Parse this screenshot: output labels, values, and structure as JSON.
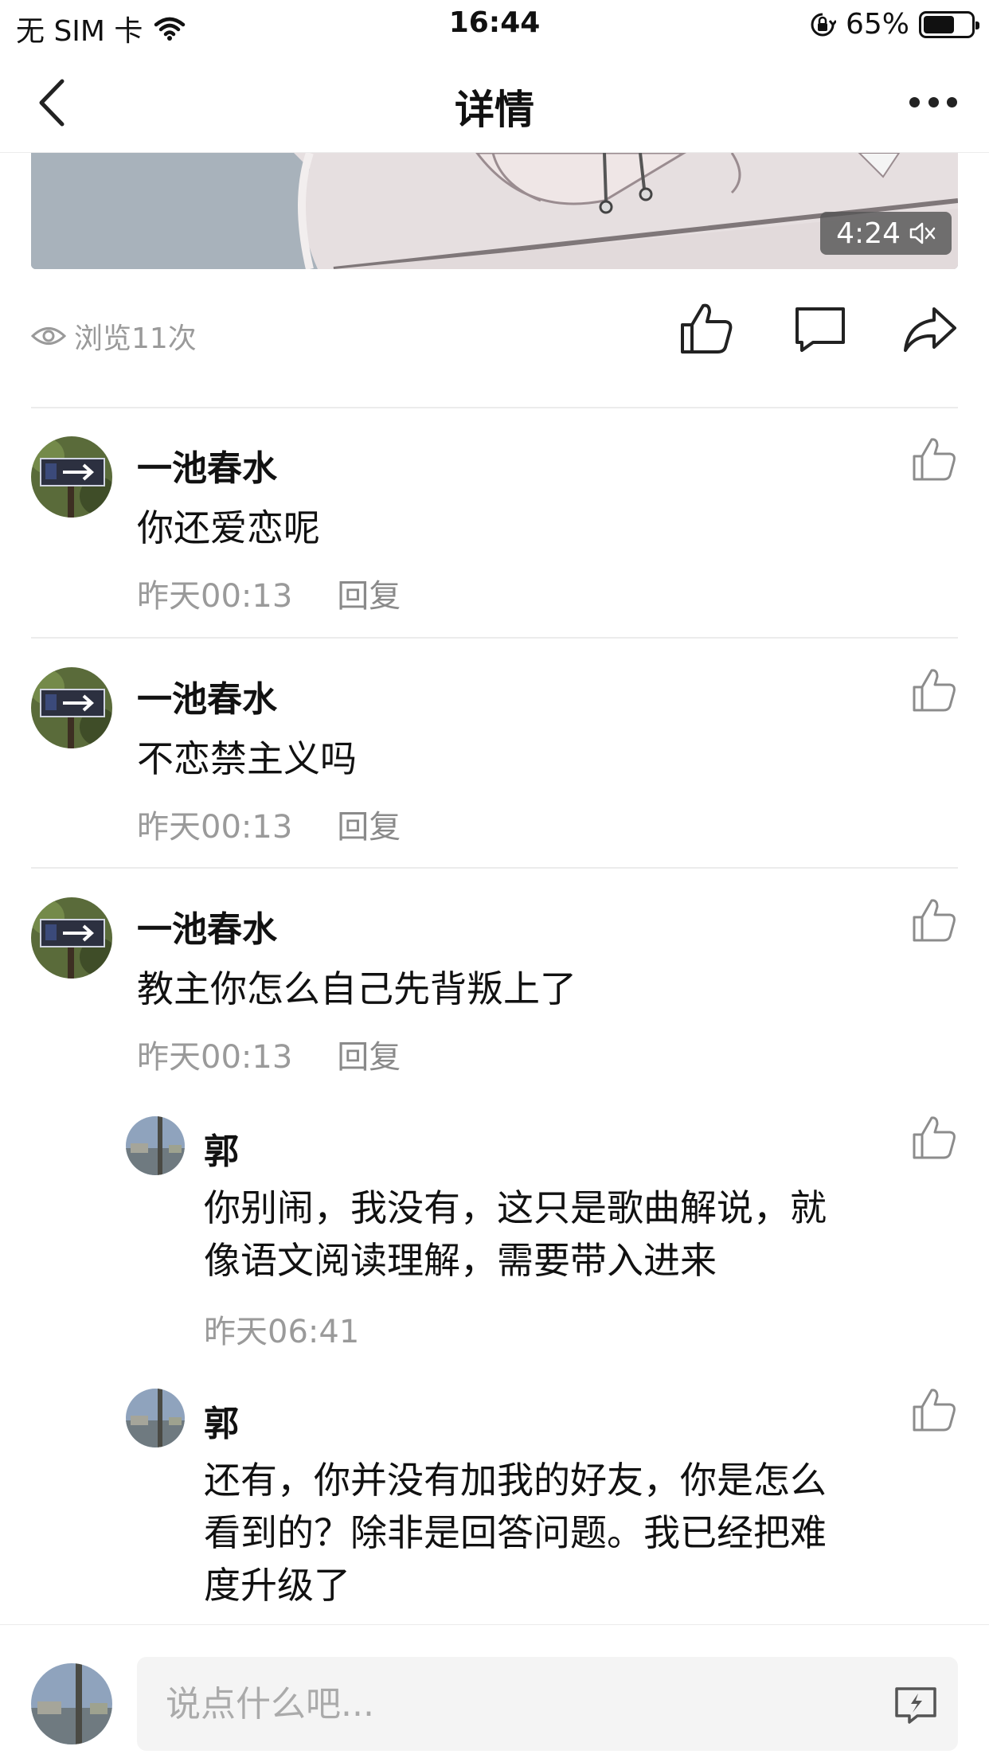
{
  "status_bar": {
    "carrier": "无 SIM 卡",
    "time": "16:44",
    "battery_percent": "65%",
    "battery_level": 0.65
  },
  "nav": {
    "title": "详情"
  },
  "video": {
    "duration": "4:24",
    "muted": true
  },
  "stats": {
    "views": "浏览11次"
  },
  "comments": [
    {
      "user": "一池春水",
      "text": "你还爱恋呢",
      "time": "昨天00:13",
      "reply": "回复"
    },
    {
      "user": "一池春水",
      "text": "不恋禁主义吗",
      "time": "昨天00:13",
      "reply": "回复"
    },
    {
      "user": "一池春水",
      "text": "教主你怎么自己先背叛上了",
      "time": "昨天00:13",
      "reply": "回复",
      "replies": [
        {
          "user": "郭",
          "line1": "你别闹，我没有，这只是歌曲解说，就",
          "line2": "像语文阅读理解，需要带入进来",
          "time": "昨天06:41"
        },
        {
          "user": "郭",
          "line1": "还有，你并没有加我的好友，你是怎么",
          "line2": "看到的？除非是回答问题。我已经把难",
          "line3": "度升级了"
        }
      ]
    }
  ],
  "input": {
    "placeholder": "说点什么吧..."
  },
  "icons": {
    "back": "chevron-left-icon",
    "more": "more-dots-icon",
    "eye": "eye-icon",
    "like": "thumb-up-icon",
    "comment": "comment-bubble-icon",
    "share": "share-arrow-icon",
    "mute": "speaker-muted-icon",
    "emoji": "lightning-bubble-icon",
    "wifi": "wifi-icon",
    "orientation_lock": "orientation-lock-icon"
  }
}
